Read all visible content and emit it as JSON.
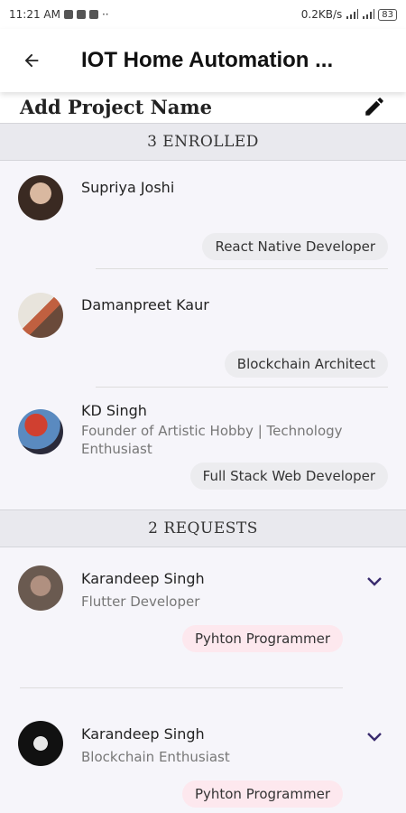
{
  "status_bar": {
    "time": "11:21 AM",
    "network_speed": "0.2KB/s",
    "battery": "83"
  },
  "app_bar": {
    "title": "IOT Home Automation ..."
  },
  "project": {
    "name": "Add Project Name"
  },
  "enrolled": {
    "header": "3 ENROLLED",
    "members": [
      {
        "name": "Supriya Joshi",
        "subtitle": "",
        "role": "React Native Developer"
      },
      {
        "name": "Damanpreet Kaur",
        "subtitle": "",
        "role": "Blockchain Architect"
      },
      {
        "name": "KD Singh",
        "subtitle_line1": "Founder of Artistic Hobby | Technology",
        "subtitle_line2": "Enthusiast",
        "role": "Full Stack Web Developer"
      }
    ]
  },
  "requests": {
    "header": "2 REQUESTS",
    "members": [
      {
        "name": "Karandeep Singh",
        "subtitle": "Flutter Developer",
        "role": "Pyhton Programmer"
      },
      {
        "name": "Karandeep Singh",
        "subtitle": "Blockchain Enthusiast",
        "role": "Pyhton Programmer"
      }
    ]
  },
  "colors": {
    "accent": "#3a2b6e",
    "chip": "#ececef",
    "request_chip": "#fde8ee",
    "section_bg": "#e9e9ee"
  }
}
